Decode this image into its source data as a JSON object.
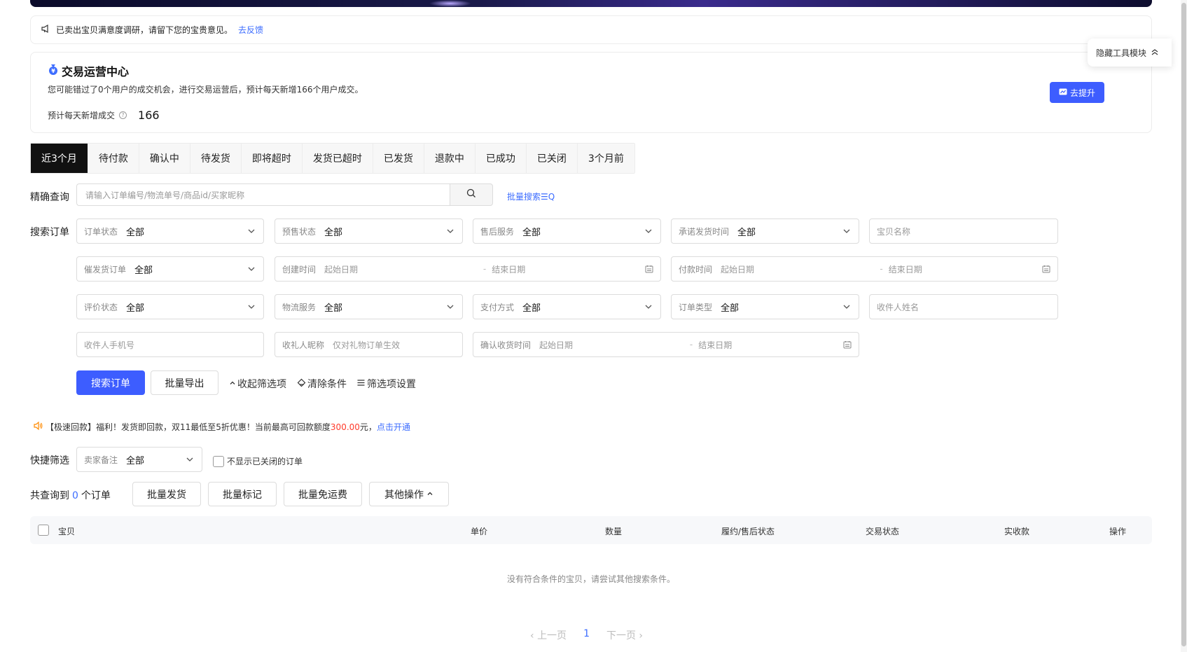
{
  "notice": {
    "text": "已卖出宝贝满意度调研，请留下您的宝贵意见。",
    "link": "去反馈"
  },
  "ops_center": {
    "title": "交易运营中心",
    "desc": "您可能错过了0个用户的成交机会，进行交易运营后，预计每天新增166个用户成交。",
    "metric_label": "预计每天新增成交",
    "metric_value": "166",
    "boost_button": "去提升"
  },
  "hide_tools": "隐藏工具模块",
  "tabs": [
    "近3个月",
    "待付款",
    "确认中",
    "待发货",
    "即将超时",
    "发货已超时",
    "已发货",
    "退款中",
    "已成功",
    "已关闭",
    "3个月前"
  ],
  "exact_query": {
    "label": "精确查询",
    "placeholder": "请输入订单编号/物流单号/商品id/买家昵称",
    "batch_search": "批量搜索☰Q"
  },
  "search_orders": {
    "label": "搜索订单",
    "fields": {
      "order_status": {
        "label": "订单状态",
        "value": "全部"
      },
      "presale_status": {
        "label": "预售状态",
        "value": "全部"
      },
      "after_sale": {
        "label": "售后服务",
        "value": "全部"
      },
      "promised_ship": {
        "label": "承诺发货时间",
        "value": "全部"
      },
      "item_name": {
        "placeholder": "宝贝名称"
      },
      "urge_ship": {
        "label": "催发货订单",
        "value": "全部"
      },
      "create_time": {
        "label": "创建时间",
        "start": "起始日期",
        "end": "结束日期"
      },
      "pay_time": {
        "label": "付款时间",
        "start": "起始日期",
        "end": "结束日期"
      },
      "review_status": {
        "label": "评价状态",
        "value": "全部"
      },
      "logistics": {
        "label": "物流服务",
        "value": "全部"
      },
      "pay_method": {
        "label": "支付方式",
        "value": "全部"
      },
      "order_type": {
        "label": "订单类型",
        "value": "全部"
      },
      "receiver_name": {
        "placeholder": "收件人姓名"
      },
      "receiver_phone": {
        "placeholder": "收件人手机号"
      },
      "gift_nick": {
        "label": "收礼人昵称",
        "placeholder": "仅对礼物订单生效"
      },
      "confirm_time": {
        "label": "确认收货时间",
        "start": "起始日期",
        "end": "结束日期"
      }
    },
    "search_button": "搜索订单",
    "export_button": "批量导出",
    "collapse": "收起筛选项",
    "clear": "清除条件",
    "settings": "筛选项设置"
  },
  "promo": {
    "text_a": "【极速回款】福利！发货即回款，双11最低至5折优惠！当前最高可回款额度",
    "amount": "300.00",
    "text_b": "元，",
    "link": "点击开通"
  },
  "quick_filter": {
    "label": "快捷筛选",
    "remark_label": "卖家备注",
    "remark_value": "全部",
    "hide_closed": "不显示已关闭的订单"
  },
  "result": {
    "prefix": "共查询到",
    "count": "0",
    "suffix": "个订单",
    "batch_ship": "批量发货",
    "batch_mark": "批量标记",
    "batch_free_ship": "批量免运费",
    "other_ops": "其他操作"
  },
  "table": {
    "headers": [
      "宝贝",
      "单价",
      "数量",
      "履约/售后状态",
      "交易状态",
      "实收款",
      "操作"
    ],
    "empty": "没有符合条件的宝贝，请尝试其他搜索条件。"
  },
  "pager": {
    "prev": "上一页",
    "page": "1",
    "next": "下一页"
  },
  "colors": {
    "primary": "#3d5dff",
    "link": "#3d6dff",
    "accent_red": "#ff3a2a"
  }
}
